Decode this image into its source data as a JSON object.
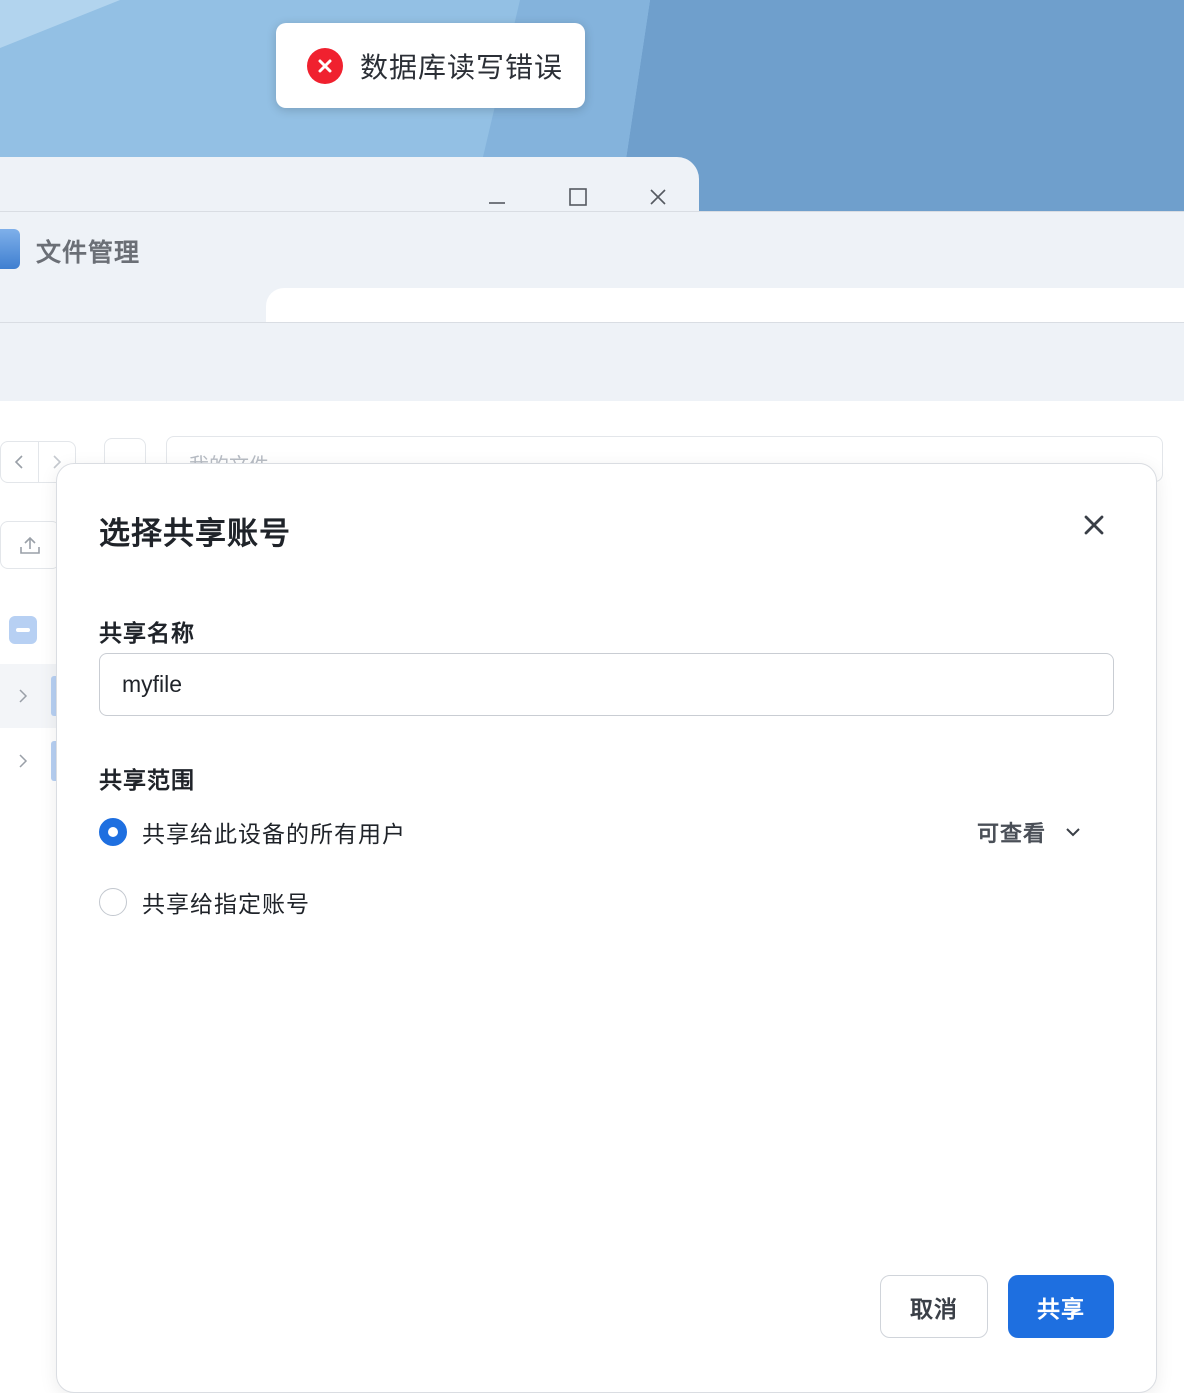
{
  "toast": {
    "icon": "error-x-icon",
    "message": "数据库读写错误",
    "color": "#f0212f"
  },
  "window": {
    "app_title": "文件管理",
    "controls": [
      "minimize-icon",
      "maximize-icon",
      "close-icon"
    ]
  },
  "file_manager": {
    "path_placeholder": "我的文件"
  },
  "dialog": {
    "title": "选择共享账号",
    "share_name_label": "共享名称",
    "share_name_value": "myfile",
    "scope_label": "共享范围",
    "options": [
      {
        "label": "共享给此设备的所有用户",
        "checked": true
      },
      {
        "label": "共享给指定账号",
        "checked": false
      }
    ],
    "permission": "可查看",
    "cancel_label": "取消",
    "share_label": "共享",
    "accent_color": "#1e6fe0"
  }
}
